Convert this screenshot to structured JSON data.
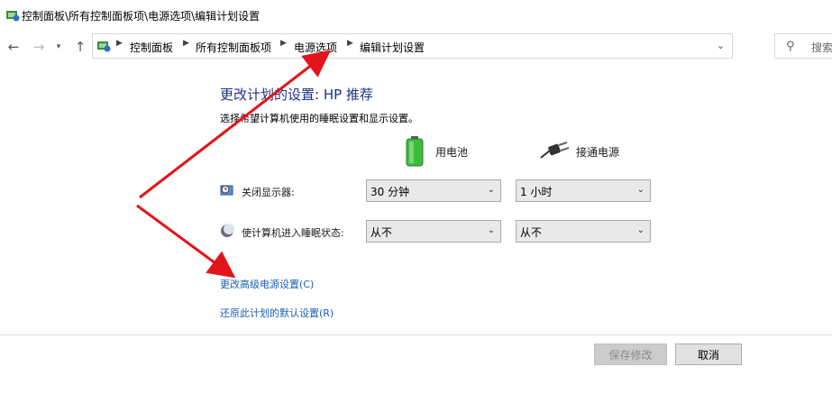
{
  "window": {
    "title": "控制面板\\所有控制面板项\\电源选项\\编辑计划设置"
  },
  "nav": {
    "back_icon": "arrow-left-icon",
    "forward_icon": "arrow-right-icon",
    "recent_icon": "chevron-down-icon",
    "up_icon": "arrow-up-icon"
  },
  "address": {
    "breadcrumbs": [
      "控制面板",
      "所有控制面板项",
      "电源选项",
      "编辑计划设置"
    ],
    "separator": "▶",
    "dropdown_glyph": "⌄",
    "refresh_glyph": "↻"
  },
  "search": {
    "placeholder": "搜索"
  },
  "content": {
    "heading": "更改计划的设置: HP 推荐",
    "subtitle": "选择希望计算机使用的睡眠设置和显示设置。",
    "columns": {
      "battery": "用电池",
      "plugged_in": "接通电源"
    },
    "rows": [
      {
        "label": "关闭显示器:",
        "battery_value": "30 分钟",
        "plugged_value": "1 小时"
      },
      {
        "label": "使计算机进入睡眠状态:",
        "battery_value": "从不",
        "plugged_value": "从不"
      }
    ],
    "links": {
      "advanced": "更改高级电源设置(C)",
      "restore": "还原此计划的默认设置(R)"
    }
  },
  "buttons": {
    "save": "保存修改",
    "cancel": "取消"
  },
  "colors": {
    "heading": "#1e3287",
    "link": "#1a5fb4",
    "annotation_arrow": "#e3141b",
    "battery_green": "#3dbb3d"
  }
}
